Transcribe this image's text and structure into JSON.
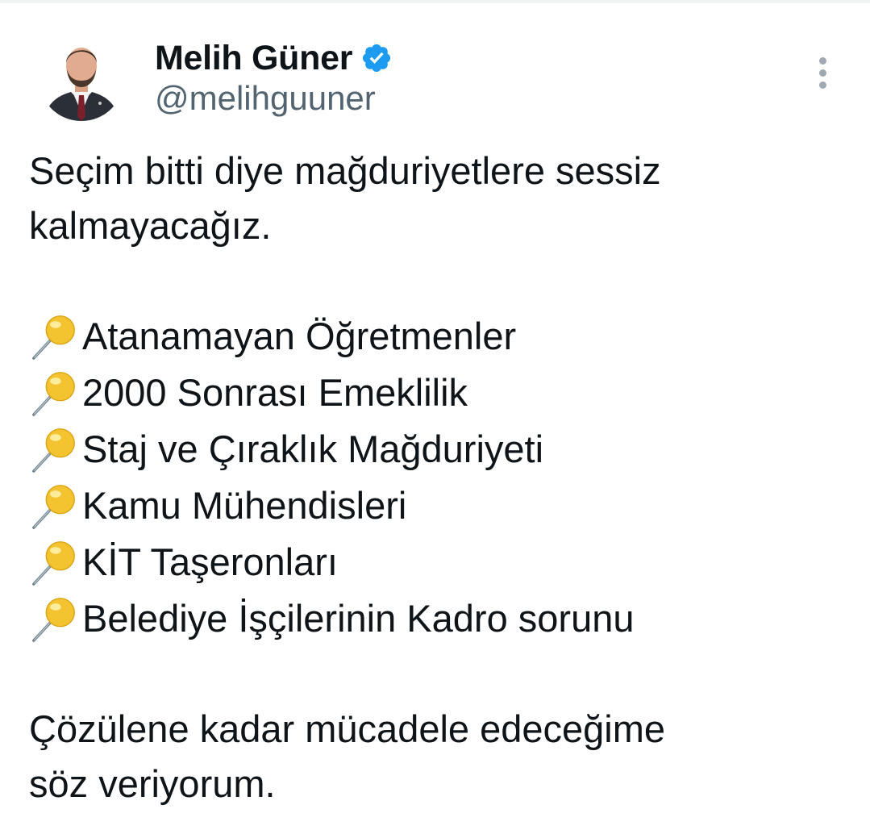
{
  "author": {
    "display_name": "Melih Güner",
    "handle": "@melihguuner",
    "verified": true,
    "verified_color": "#1d9bf0"
  },
  "icons": {
    "verified": "verified-badge-icon",
    "more": "more-options-icon",
    "bullet": "round-pushpin-emoji"
  },
  "tweet": {
    "intro_line1": "Seçim bitti diye mağduriyetlere sessiz",
    "intro_line2": "kalmayacağız.",
    "items": [
      "Atanamayan Öğretmenler",
      "2000 Sonrası Emeklilik",
      "Staj ve Çıraklık Mağduriyeti",
      "Kamu Mühendisleri",
      "KİT Taşeronları",
      "Belediye İşçilerinin Kadro sorunu"
    ],
    "closing_line1": "Çözülene kadar mücadele edeceğime",
    "closing_line2": "söz veriyorum."
  },
  "colors": {
    "text": "#0f1419",
    "secondary": "#536471",
    "pin_head": "#f4c430"
  }
}
